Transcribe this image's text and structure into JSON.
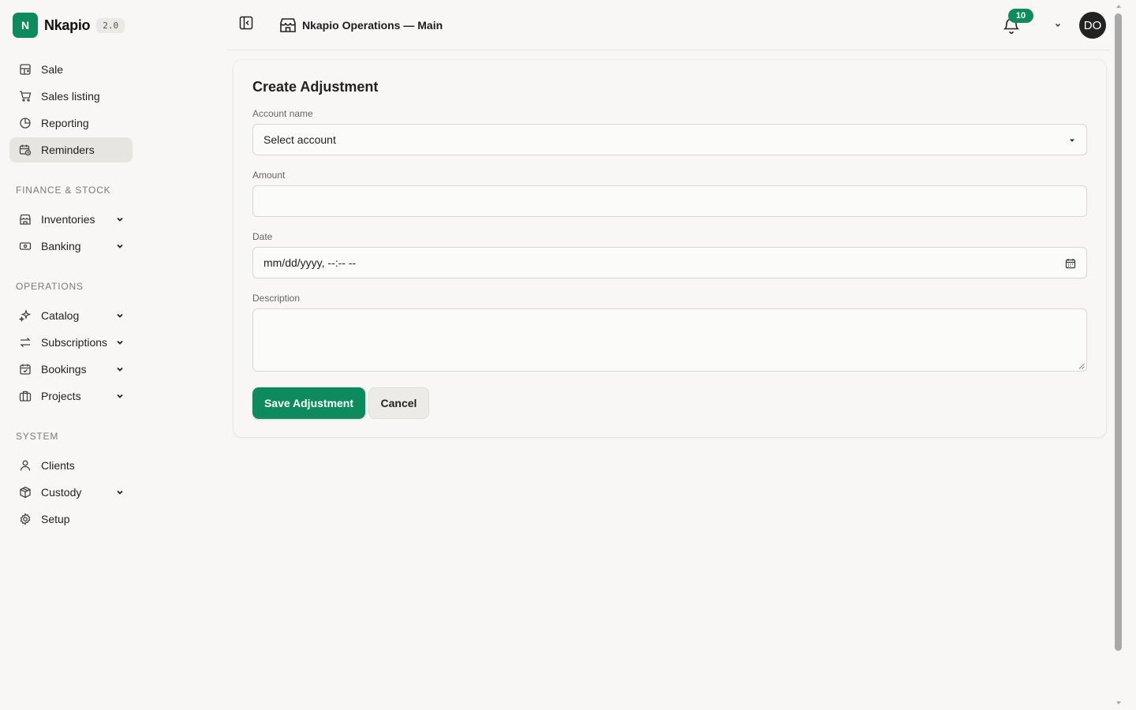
{
  "brand": {
    "logo_letter": "N",
    "name": "Nkapio",
    "version": "2.0",
    "accent": "#0e8a5f"
  },
  "sidebar": {
    "items_top": [
      {
        "label": "Sale",
        "icon": "pos-grid-icon"
      },
      {
        "label": "Sales listing",
        "icon": "cart-icon"
      },
      {
        "label": "Reporting",
        "icon": "pie-chart-icon"
      },
      {
        "label": "Reminders",
        "icon": "calendar-clock-icon",
        "active": true
      }
    ],
    "sections": [
      {
        "title": "FINANCE & STOCK",
        "items": [
          {
            "label": "Inventories",
            "icon": "store-icon",
            "expandable": true
          },
          {
            "label": "Banking",
            "icon": "banknote-icon",
            "expandable": true
          }
        ]
      },
      {
        "title": "OPERATIONS",
        "items": [
          {
            "label": "Catalog",
            "icon": "sparkles-icon",
            "expandable": true
          },
          {
            "label": "Subscriptions",
            "icon": "repeat-icon",
            "expandable": true
          },
          {
            "label": "Bookings",
            "icon": "calendar-check-icon",
            "expandable": true
          },
          {
            "label": "Projects",
            "icon": "briefcase-icon",
            "expandable": true
          }
        ]
      },
      {
        "title": "SYSTEM",
        "items": [
          {
            "label": "Clients",
            "icon": "user-icon",
            "expandable": false
          },
          {
            "label": "Custody",
            "icon": "package-icon",
            "expandable": true
          },
          {
            "label": "Setup",
            "icon": "gear-icon",
            "expandable": false
          }
        ]
      }
    ]
  },
  "header": {
    "store_name": "Nkapio Operations — Main",
    "notifications_count": "10",
    "avatar_initials": "DO"
  },
  "form": {
    "title": "Create Adjustment",
    "account": {
      "label": "Account name",
      "value": "Select account"
    },
    "amount": {
      "label": "Amount",
      "value": ""
    },
    "date": {
      "label": "Date",
      "placeholder": "mm/dd/yyyy, --:-- --"
    },
    "description": {
      "label": "Description",
      "value": ""
    },
    "save_label": "Save Adjustment",
    "cancel_label": "Cancel"
  }
}
